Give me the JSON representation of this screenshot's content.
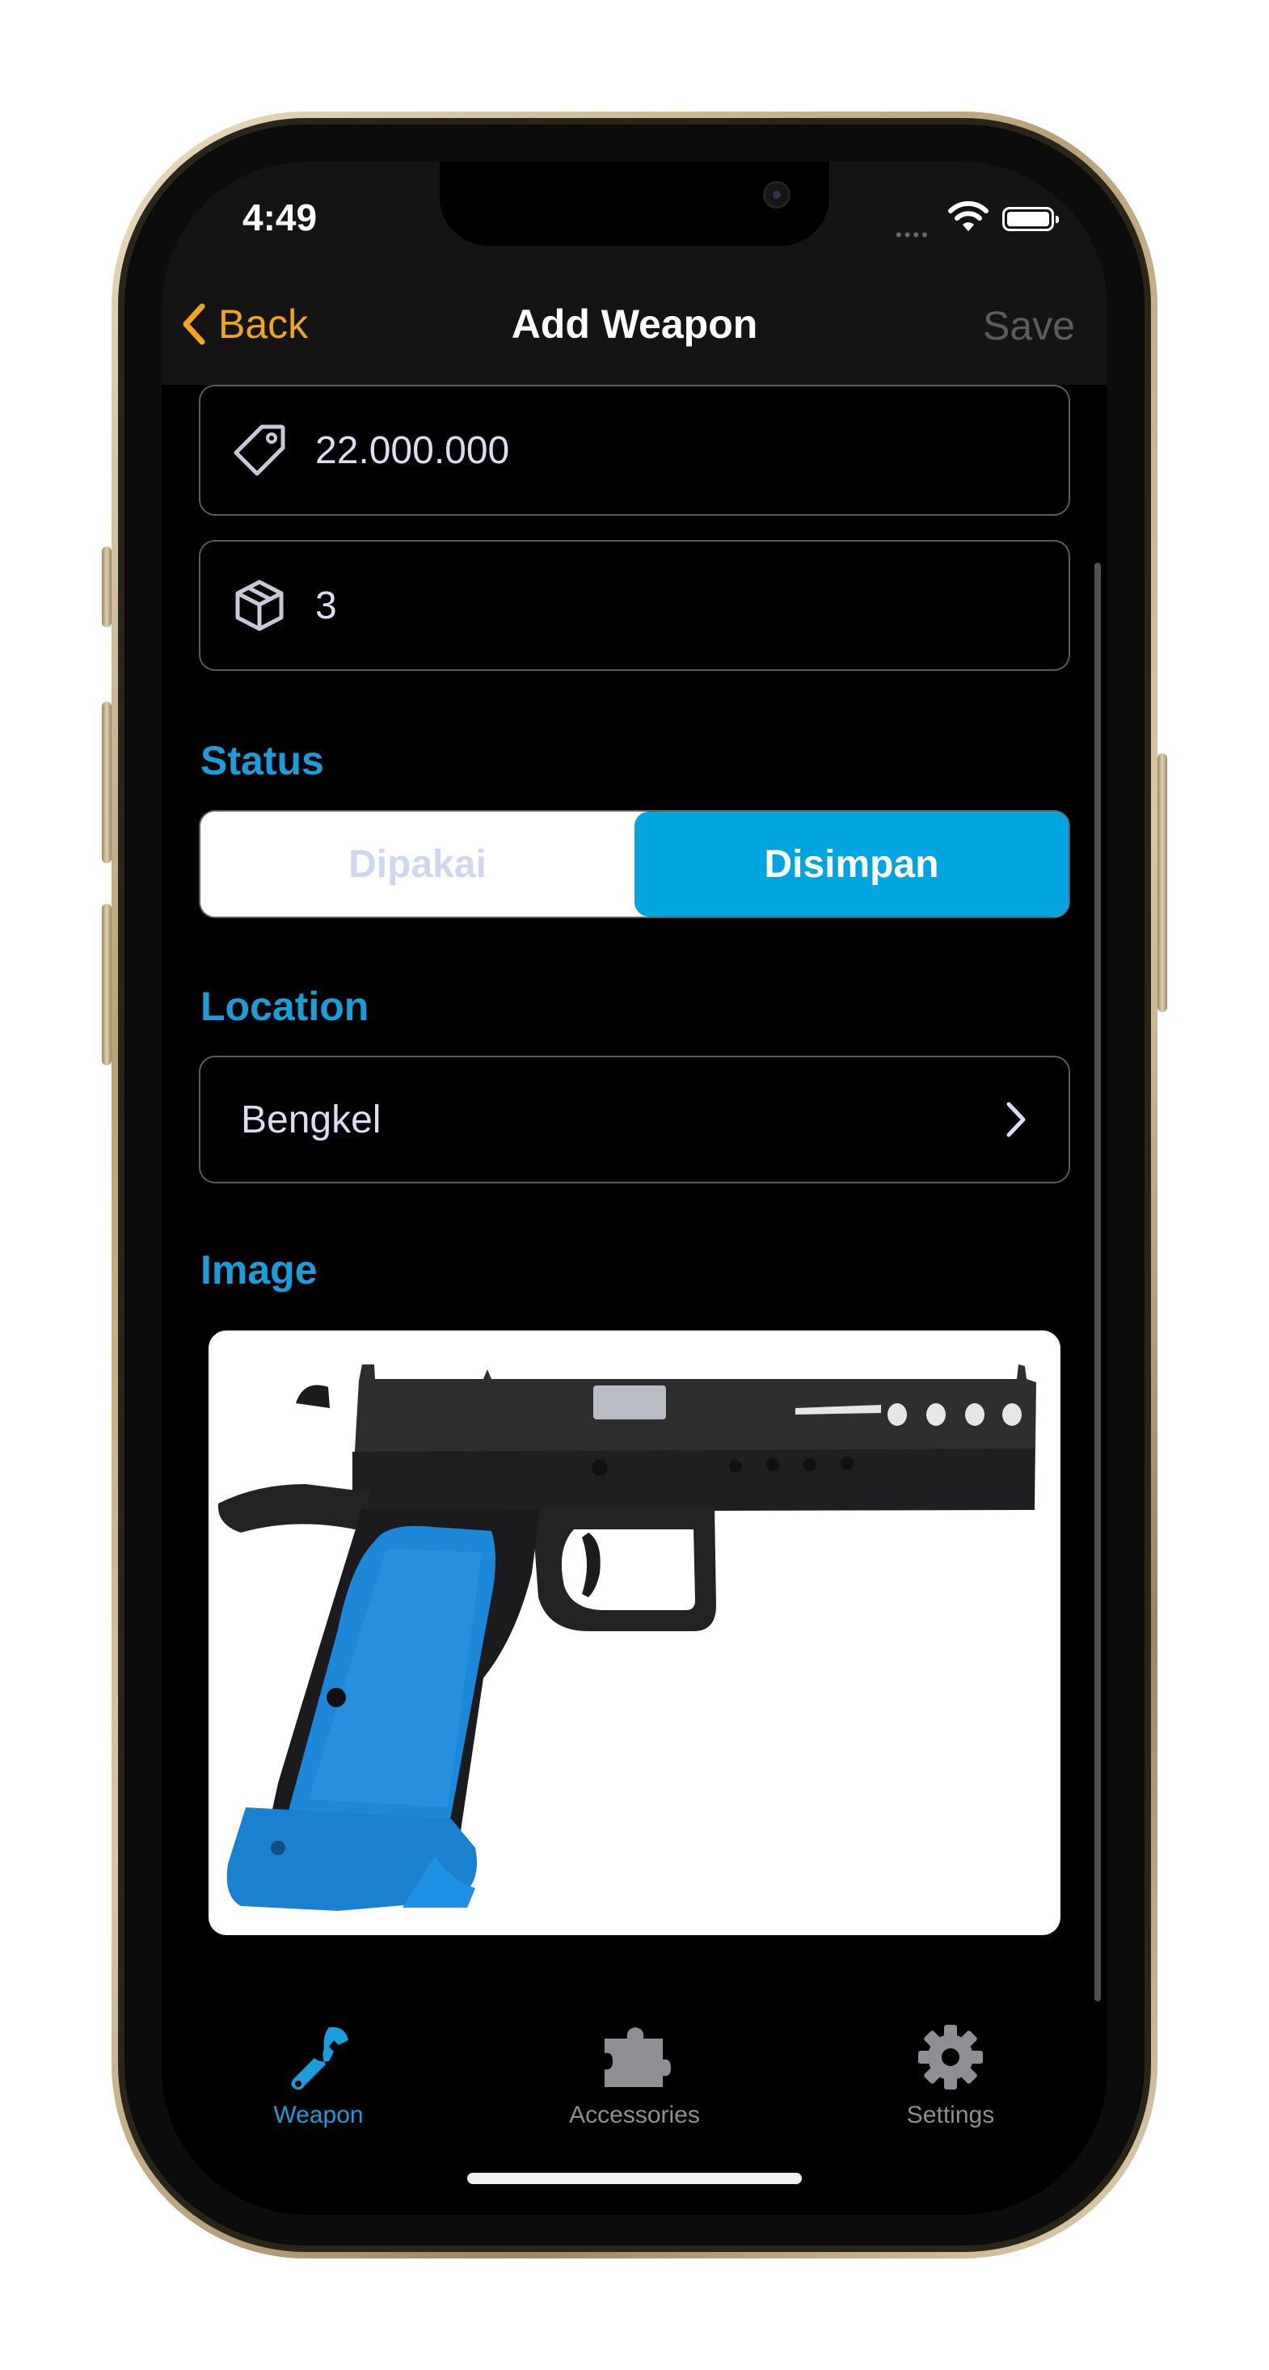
{
  "status_bar": {
    "time": "4:49"
  },
  "nav": {
    "back_label": "Back",
    "title": "Add Weapon",
    "save_label": "Save"
  },
  "fields": {
    "price": {
      "value": "22.000.000",
      "icon": "tag-icon"
    },
    "quantity": {
      "value": "3",
      "icon": "box-icon"
    }
  },
  "status": {
    "section_label": "Status",
    "options": [
      "Dipakai",
      "Disimpan"
    ],
    "selected": "Disimpan"
  },
  "location": {
    "section_label": "Location",
    "value": "Bengkel"
  },
  "image": {
    "section_label": "Image"
  },
  "tabbar": {
    "items": [
      {
        "label": "Weapon",
        "icon": "wrench-icon",
        "active": true
      },
      {
        "label": "Accessories",
        "icon": "puzzle-icon",
        "active": false
      },
      {
        "label": "Settings",
        "icon": "gear-icon",
        "active": false
      }
    ]
  },
  "colors": {
    "accent": "#199ed9",
    "segment_selected": "#00a5df",
    "back": "#f0a51b",
    "save_disabled": "#5c5c5c",
    "tab_inactive": "#8e8e93"
  }
}
